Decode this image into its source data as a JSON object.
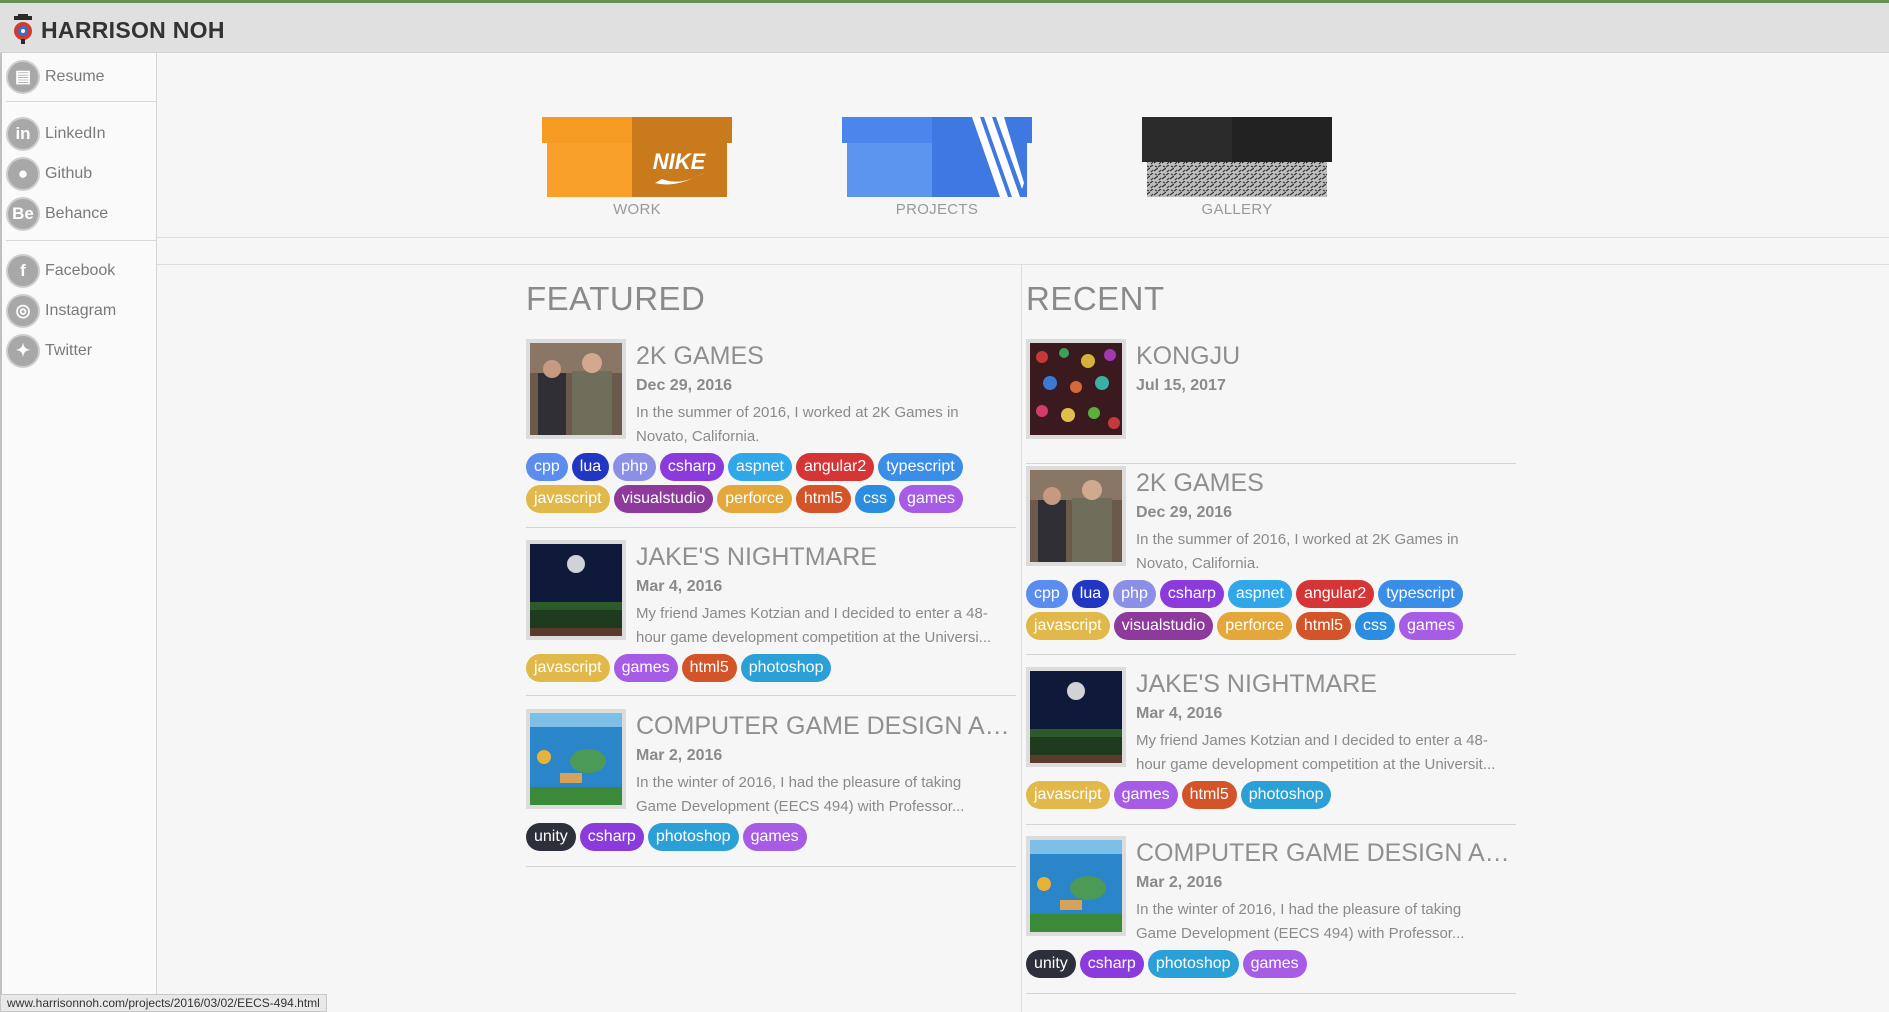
{
  "brand": {
    "name": "HARRISON NOH"
  },
  "sidebar": {
    "items": [
      {
        "label": "Resume",
        "icon": "resume-icon",
        "glyph": "▤"
      },
      {
        "label": "LinkedIn",
        "icon": "linkedin-icon",
        "glyph": "in"
      },
      {
        "label": "Github",
        "icon": "github-icon",
        "glyph": "●"
      },
      {
        "label": "Behance",
        "icon": "behance-icon",
        "glyph": "Be"
      },
      {
        "label": "Facebook",
        "icon": "facebook-icon",
        "glyph": "f"
      },
      {
        "label": "Instagram",
        "icon": "instagram-icon",
        "glyph": "◎"
      },
      {
        "label": "Twitter",
        "icon": "twitter-icon",
        "glyph": "✦"
      }
    ]
  },
  "hero": {
    "work": "WORK",
    "projects": "PROJECTS",
    "gallery": "GALLERY"
  },
  "featured": {
    "title": "FEATURED",
    "cards": [
      {
        "title": "2K GAMES",
        "date": "Dec 29, 2016",
        "desc": [
          "In the summer of 2016, I worked at 2K Games in",
          "Novato, California."
        ],
        "tags": [
          "cpp",
          "lua",
          "php",
          "csharp",
          "aspnet",
          "angular2",
          "typescript",
          "javascript",
          "visualstudio",
          "perforce",
          "html5",
          "css",
          "games"
        ]
      },
      {
        "title": "JAKE'S NIGHTMARE",
        "date": "Mar 4, 2016",
        "desc": [
          "My friend James Kotzian and I decided to enter a 48-",
          "hour game development competition at the Universi..."
        ],
        "tags": [
          "javascript",
          "games",
          "html5",
          "photoshop"
        ]
      },
      {
        "title": "COMPUTER GAME DESIGN AN...",
        "date": "Mar 2, 2016",
        "desc": [
          "In the winter of 2016, I had the pleasure of taking",
          "Game Development (EECS 494) with Professor..."
        ],
        "tags": [
          "unity",
          "csharp",
          "photoshop",
          "games"
        ]
      }
    ]
  },
  "recent": {
    "title": "RECENT",
    "cards": [
      {
        "title": "KONGJU",
        "date": "Jul 15, 2017",
        "desc": [],
        "tags": []
      },
      {
        "title": "2K GAMES",
        "date": "Dec 29, 2016",
        "desc": [
          "In the summer of 2016, I worked at 2K Games in",
          "Novato, California."
        ],
        "tags": [
          "cpp",
          "lua",
          "php",
          "csharp",
          "aspnet",
          "angular2",
          "typescript",
          "javascript",
          "visualstudio",
          "perforce",
          "html5",
          "css",
          "games"
        ]
      },
      {
        "title": "JAKE'S NIGHTMARE",
        "date": "Mar 4, 2016",
        "desc": [
          "My friend James Kotzian and I decided to enter a 48-",
          "hour game development competition at the Universit..."
        ],
        "tags": [
          "javascript",
          "games",
          "html5",
          "photoshop"
        ]
      },
      {
        "title": "COMPUTER GAME DESIGN AN...",
        "date": "Mar 2, 2016",
        "desc": [
          "In the winter of 2016, I had the pleasure of taking",
          "Game Development (EECS 494) with Professor..."
        ],
        "tags": [
          "unity",
          "csharp",
          "photoshop",
          "games"
        ]
      }
    ]
  },
  "tag_colors": {
    "cpp": "#5b8def",
    "lua": "#2236c4",
    "php": "#8b8fe6",
    "csharp": "#8b3bdc",
    "aspnet": "#2fa7e8",
    "angular2": "#d63535",
    "typescript": "#3a8ee8",
    "javascript": "#e0b94a",
    "visualstudio": "#8e3a9d",
    "perforce": "#e3a73a",
    "html5": "#d4542a",
    "css": "#2b8de0",
    "games": "#a75ce6",
    "photoshop": "#2ba0d6",
    "unity": "#2d2f3a"
  },
  "status": {
    "url": "www.harrisonnoh.com/projects/2016/03/02/EECS-494.html"
  }
}
